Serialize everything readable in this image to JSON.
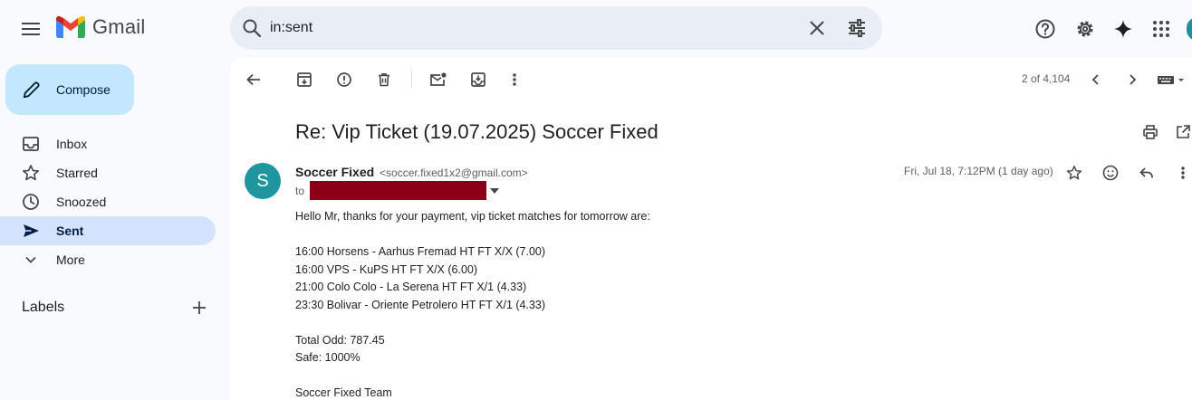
{
  "app": {
    "name": "Gmail"
  },
  "search": {
    "value": "in:sent"
  },
  "sidebar": {
    "compose_label": "Compose",
    "items": [
      {
        "label": "Inbox"
      },
      {
        "label": "Starred"
      },
      {
        "label": "Snoozed"
      },
      {
        "label": "Sent",
        "active": true
      },
      {
        "label": "More"
      }
    ],
    "labels_title": "Labels"
  },
  "toolbar": {
    "pager": "2 of 4,104"
  },
  "email": {
    "subject": "Re: Vip Ticket (19.07.2025) Soccer Fixed",
    "avatar_letter": "S",
    "sender_name": "Soccer Fixed",
    "sender_email": "<soccer.fixed1x2@gmail.com>",
    "to_label": "to",
    "date": "Fri, Jul 18, 7:12PM (1 day ago)",
    "body_lines": [
      "Hello Mr, thanks for your payment, vip ticket matches for tomorrow are:",
      "",
      "16:00 Horsens - Aarhus Fremad HT FT X/X (7.00)",
      "16:00 VPS - KuPS HT FT X/X (6.00)",
      "21:00 Colo Colo - La Serena HT FT X/1 (4.33)",
      "23:30 Bolivar - Oriente Petrolero HT FT X/1 (4.33)",
      "",
      "Total Odd: 787.45",
      "Safe: 1000%",
      "",
      "Soccer Fixed Team"
    ]
  },
  "colors": {
    "compose_bg": "#c2e7ff",
    "active_nav": "#d3e3fd",
    "avatar": "#1f969f",
    "redaction": "#8b0015"
  }
}
